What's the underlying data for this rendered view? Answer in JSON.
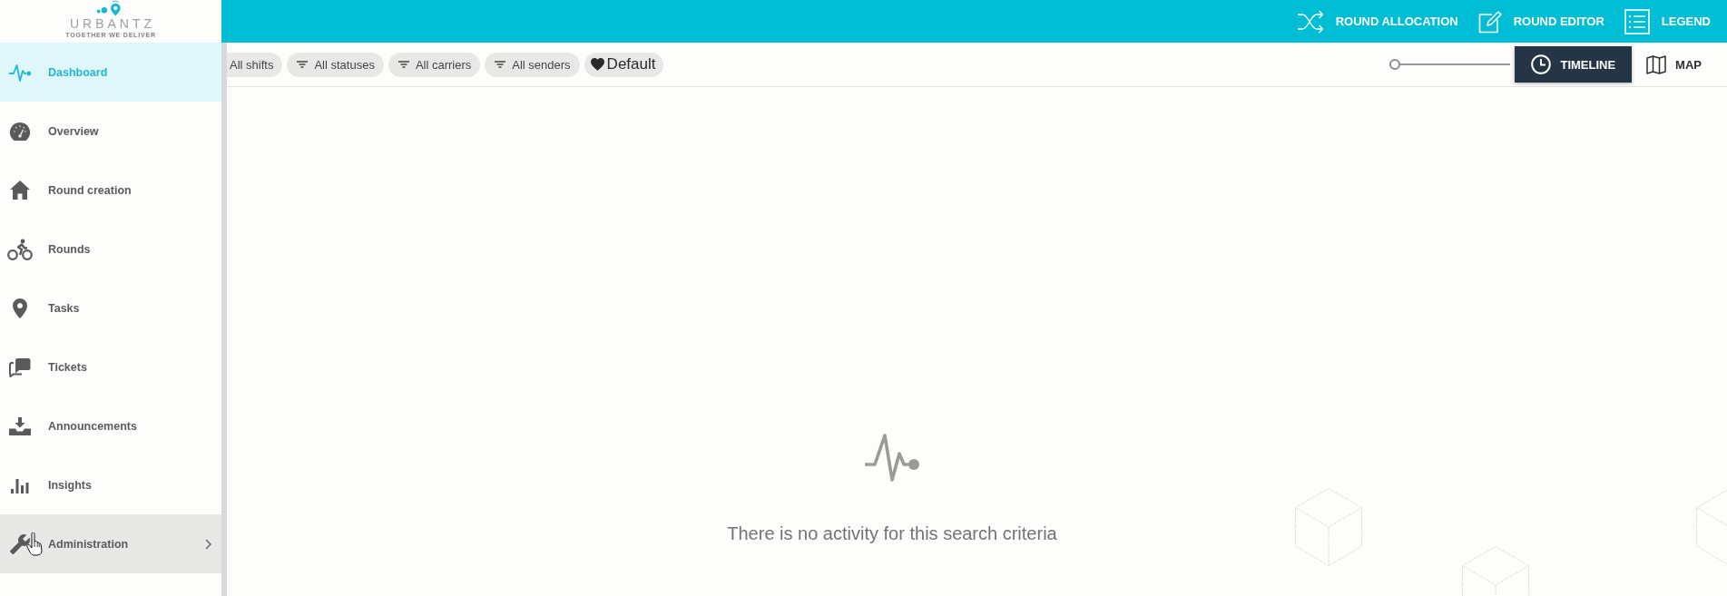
{
  "logo": {
    "name": "URBANTZ",
    "tagline": "TOGETHER WE DELIVER"
  },
  "top_bar": {
    "actions": [
      {
        "label": "ROUND ALLOCATION",
        "kind": "shuffle"
      },
      {
        "label": "ROUND EDITOR",
        "kind": "edit"
      },
      {
        "label": "LEGEND",
        "kind": "list"
      }
    ]
  },
  "sidebar": {
    "items": [
      {
        "label": "Dashboard",
        "kind": "pulse",
        "selected": true,
        "hovered": false,
        "expandable": false
      },
      {
        "label": "Overview",
        "kind": "gauge",
        "selected": false,
        "hovered": false,
        "expandable": false
      },
      {
        "label": "Round creation",
        "kind": "house",
        "selected": false,
        "hovered": false,
        "expandable": false
      },
      {
        "label": "Rounds",
        "kind": "bike",
        "selected": false,
        "hovered": false,
        "expandable": false
      },
      {
        "label": "Tasks",
        "kind": "pin",
        "selected": false,
        "hovered": false,
        "expandable": false
      },
      {
        "label": "Tickets",
        "kind": "chat",
        "selected": false,
        "hovered": false,
        "expandable": false
      },
      {
        "label": "Announcements",
        "kind": "inbox",
        "selected": false,
        "hovered": false,
        "expandable": false
      },
      {
        "label": "Insights",
        "kind": "bars",
        "selected": false,
        "hovered": false,
        "expandable": false
      },
      {
        "label": "Administration",
        "kind": "wrench",
        "selected": false,
        "hovered": true,
        "expandable": true
      }
    ]
  },
  "filters": [
    {
      "label": "All shifts",
      "kind": "plain"
    },
    {
      "label": "All statuses",
      "kind": "filter"
    },
    {
      "label": "All carriers",
      "kind": "filter"
    },
    {
      "label": "All senders",
      "kind": "filter"
    },
    {
      "label": "Default",
      "kind": "favorite"
    }
  ],
  "zoom_slider": {
    "level": 0
  },
  "views": [
    {
      "label": "TIMELINE",
      "kind": "clock",
      "selected": true
    },
    {
      "label": "MAP",
      "kind": "map",
      "selected": false
    }
  ],
  "empty_state": {
    "message": "There is no activity for this search criteria"
  }
}
